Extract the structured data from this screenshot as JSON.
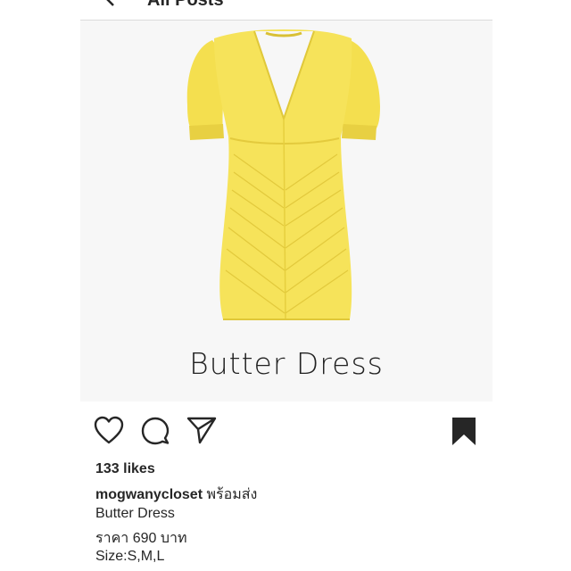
{
  "header": {
    "title": "All Posts"
  },
  "post": {
    "image_caption": "Butter Dress",
    "likes": "133 likes",
    "username": "mogwanycloset",
    "caption_first": "พร้อมส่ง",
    "caption_lines": [
      "Butter Dress",
      "ราคา 690 บาท",
      "Size:S,M,L"
    ]
  },
  "colors": {
    "dress": "#f6e35a",
    "dress_shade": "#e6cf3e",
    "background": "#f7f7f7"
  }
}
